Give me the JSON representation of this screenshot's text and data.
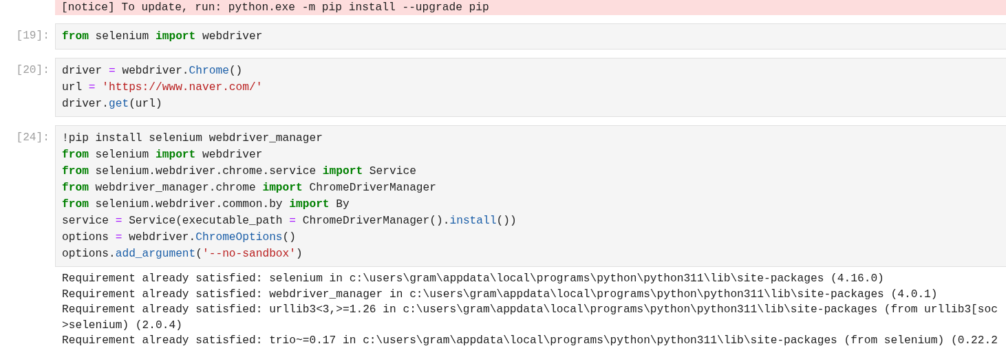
{
  "notice": "[notice] To update, run: python.exe -m pip install --upgrade pip",
  "cells": [
    {
      "prompt": "[19]:",
      "lines": [
        [
          {
            "kind": "keyword",
            "text": "from"
          },
          {
            "kind": "name",
            "text": " selenium "
          },
          {
            "kind": "keyword",
            "text": "import"
          },
          {
            "kind": "name",
            "text": " webdriver"
          }
        ]
      ]
    },
    {
      "prompt": "[20]:",
      "lines": [
        [
          {
            "kind": "name",
            "text": "driver "
          },
          {
            "kind": "operator",
            "text": "="
          },
          {
            "kind": "name",
            "text": " webdriver."
          },
          {
            "kind": "call",
            "text": "Chrome"
          },
          {
            "kind": "name",
            "text": "()"
          }
        ],
        [
          {
            "kind": "name",
            "text": "url "
          },
          {
            "kind": "operator",
            "text": "="
          },
          {
            "kind": "string",
            "text": " 'https://www.naver.com/'"
          }
        ],
        [
          {
            "kind": "name",
            "text": "driver."
          },
          {
            "kind": "call",
            "text": "get"
          },
          {
            "kind": "name",
            "text": "(url)"
          }
        ]
      ]
    },
    {
      "prompt": "[24]:",
      "lines": [
        [
          {
            "kind": "name",
            "text": "!pip install selenium webdriver_manager"
          }
        ],
        [
          {
            "kind": "keyword",
            "text": "from"
          },
          {
            "kind": "name",
            "text": " selenium "
          },
          {
            "kind": "keyword",
            "text": "import"
          },
          {
            "kind": "name",
            "text": " webdriver"
          }
        ],
        [
          {
            "kind": "keyword",
            "text": "from"
          },
          {
            "kind": "name",
            "text": " selenium.webdriver.chrome.service "
          },
          {
            "kind": "keyword",
            "text": "import"
          },
          {
            "kind": "name",
            "text": " Service"
          }
        ],
        [
          {
            "kind": "keyword",
            "text": "from"
          },
          {
            "kind": "name",
            "text": " webdriver_manager.chrome "
          },
          {
            "kind": "keyword",
            "text": "import"
          },
          {
            "kind": "name",
            "text": " ChromeDriverManager"
          }
        ],
        [
          {
            "kind": "keyword",
            "text": "from"
          },
          {
            "kind": "name",
            "text": " selenium.webdriver.common.by "
          },
          {
            "kind": "keyword",
            "text": "import"
          },
          {
            "kind": "name",
            "text": " By"
          }
        ],
        [
          {
            "kind": "name",
            "text": "service "
          },
          {
            "kind": "operator",
            "text": "="
          },
          {
            "kind": "name",
            "text": " Service(executable_path "
          },
          {
            "kind": "operator",
            "text": "="
          },
          {
            "kind": "name",
            "text": " ChromeDriverManager()."
          },
          {
            "kind": "call",
            "text": "install"
          },
          {
            "kind": "name",
            "text": "())"
          }
        ],
        [
          {
            "kind": "name",
            "text": "options "
          },
          {
            "kind": "operator",
            "text": "="
          },
          {
            "kind": "name",
            "text": " webdriver."
          },
          {
            "kind": "call",
            "text": "ChromeOptions"
          },
          {
            "kind": "name",
            "text": "()"
          }
        ],
        [
          {
            "kind": "name",
            "text": "options."
          },
          {
            "kind": "call",
            "text": "add_argument"
          },
          {
            "kind": "name",
            "text": "("
          },
          {
            "kind": "string",
            "text": "'--no-sandbox'"
          },
          {
            "kind": "name",
            "text": ")"
          }
        ]
      ],
      "output": [
        "Requirement already satisfied: selenium in c:\\users\\gram\\appdata\\local\\programs\\python\\python311\\lib\\site-packages (4.16.0)",
        "Requirement already satisfied: webdriver_manager in c:\\users\\gram\\appdata\\local\\programs\\python\\python311\\lib\\site-packages (4.0.1)",
        "Requirement already satisfied: urllib3<3,>=1.26 in c:\\users\\gram\\appdata\\local\\programs\\python\\python311\\lib\\site-packages (from urllib3[soc",
        ">selenium) (2.0.4)",
        "Requirement already satisfied: trio~=0.17 in c:\\users\\gram\\appdata\\local\\programs\\python\\python311\\lib\\site-packages (from selenium) (0.22.2"
      ]
    }
  ]
}
